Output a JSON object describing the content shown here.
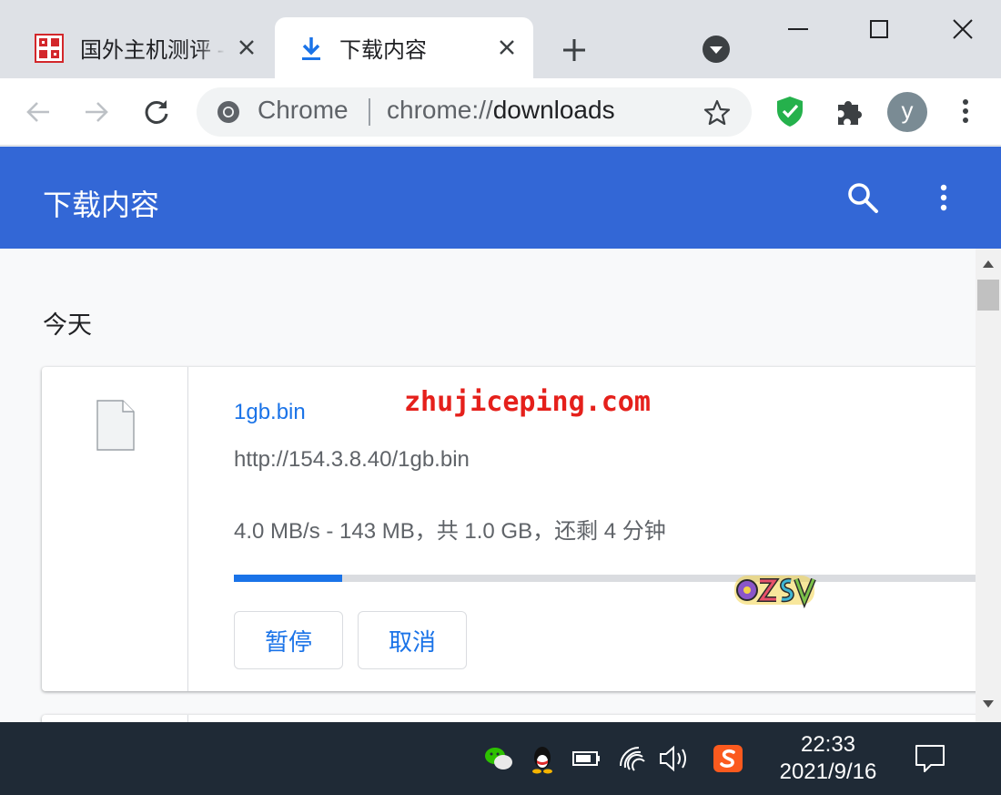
{
  "tabs": [
    {
      "title": "国外主机测评 - "
    },
    {
      "title": "下载内容"
    }
  ],
  "omnibox": {
    "chip": "Chrome",
    "url_scheme": "chrome://",
    "url_host": "downloads"
  },
  "profile": {
    "initial": "y"
  },
  "downloads_page": {
    "title": "下载内容",
    "date_header": "今天",
    "item": {
      "file_name": "1gb.bin",
      "url": "http://154.3.8.40/1gb.bin",
      "status": "4.0 MB/s - 143 MB，共 1.0 GB，还剩 4 分钟",
      "progress_fraction": 0.143,
      "pause_label": "暂停",
      "cancel_label": "取消"
    }
  },
  "watermarks": {
    "site": "zhujiceping.com",
    "logo": "OZSV"
  },
  "taskbar": {
    "time": "22:33",
    "date": "2021/9/16"
  },
  "colors": {
    "header_blue": "#3367d6",
    "link_blue": "#1a73e8",
    "watermark_red": "#e5201b",
    "taskbar": "#1f2a36"
  },
  "icons": [
    "tab-favicon-icon",
    "download-icon",
    "close-icon",
    "plus-icon",
    "tab-search-icon",
    "minimize-icon",
    "maximize-icon",
    "window-close-icon",
    "back-icon",
    "forward-icon",
    "reload-icon",
    "chrome-icon",
    "star-icon",
    "shield-icon",
    "puzzle-icon",
    "more-vert-icon",
    "search-icon",
    "file-icon",
    "wechat-icon",
    "qq-icon",
    "battery-icon",
    "wifi-icon",
    "volume-icon",
    "sogou-icon",
    "notification-icon"
  ]
}
